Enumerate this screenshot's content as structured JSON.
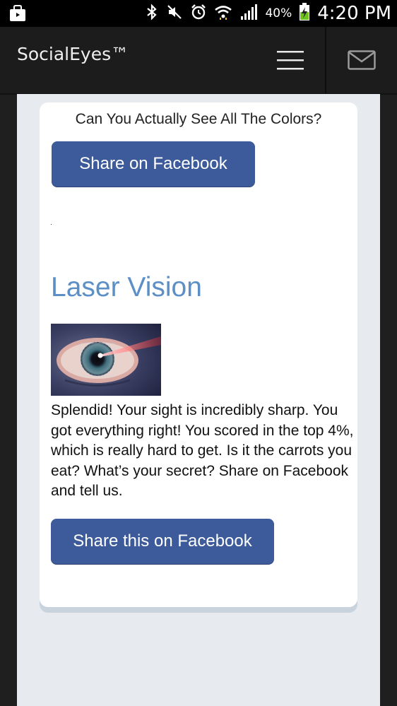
{
  "status_bar": {
    "battery": "40%",
    "time": "4:20 PM"
  },
  "header": {
    "brand": "SocialEyes™"
  },
  "quiz": {
    "title": "Can You Actually See All The Colors?",
    "share_button_1": "Share on Facebook"
  },
  "result": {
    "title": "Laser Vision",
    "description": "Splendid! Your sight is incredibly sharp. You got everything right! You scored in the top 4%, which is really hard to get. Is it the carrots you eat? What’s your secret? Share on Facebook and tell us.",
    "share_button_2": "Share this on Facebook"
  },
  "colors": {
    "facebook_blue": "#3d5a9a",
    "result_title": "#5b8fc6"
  }
}
